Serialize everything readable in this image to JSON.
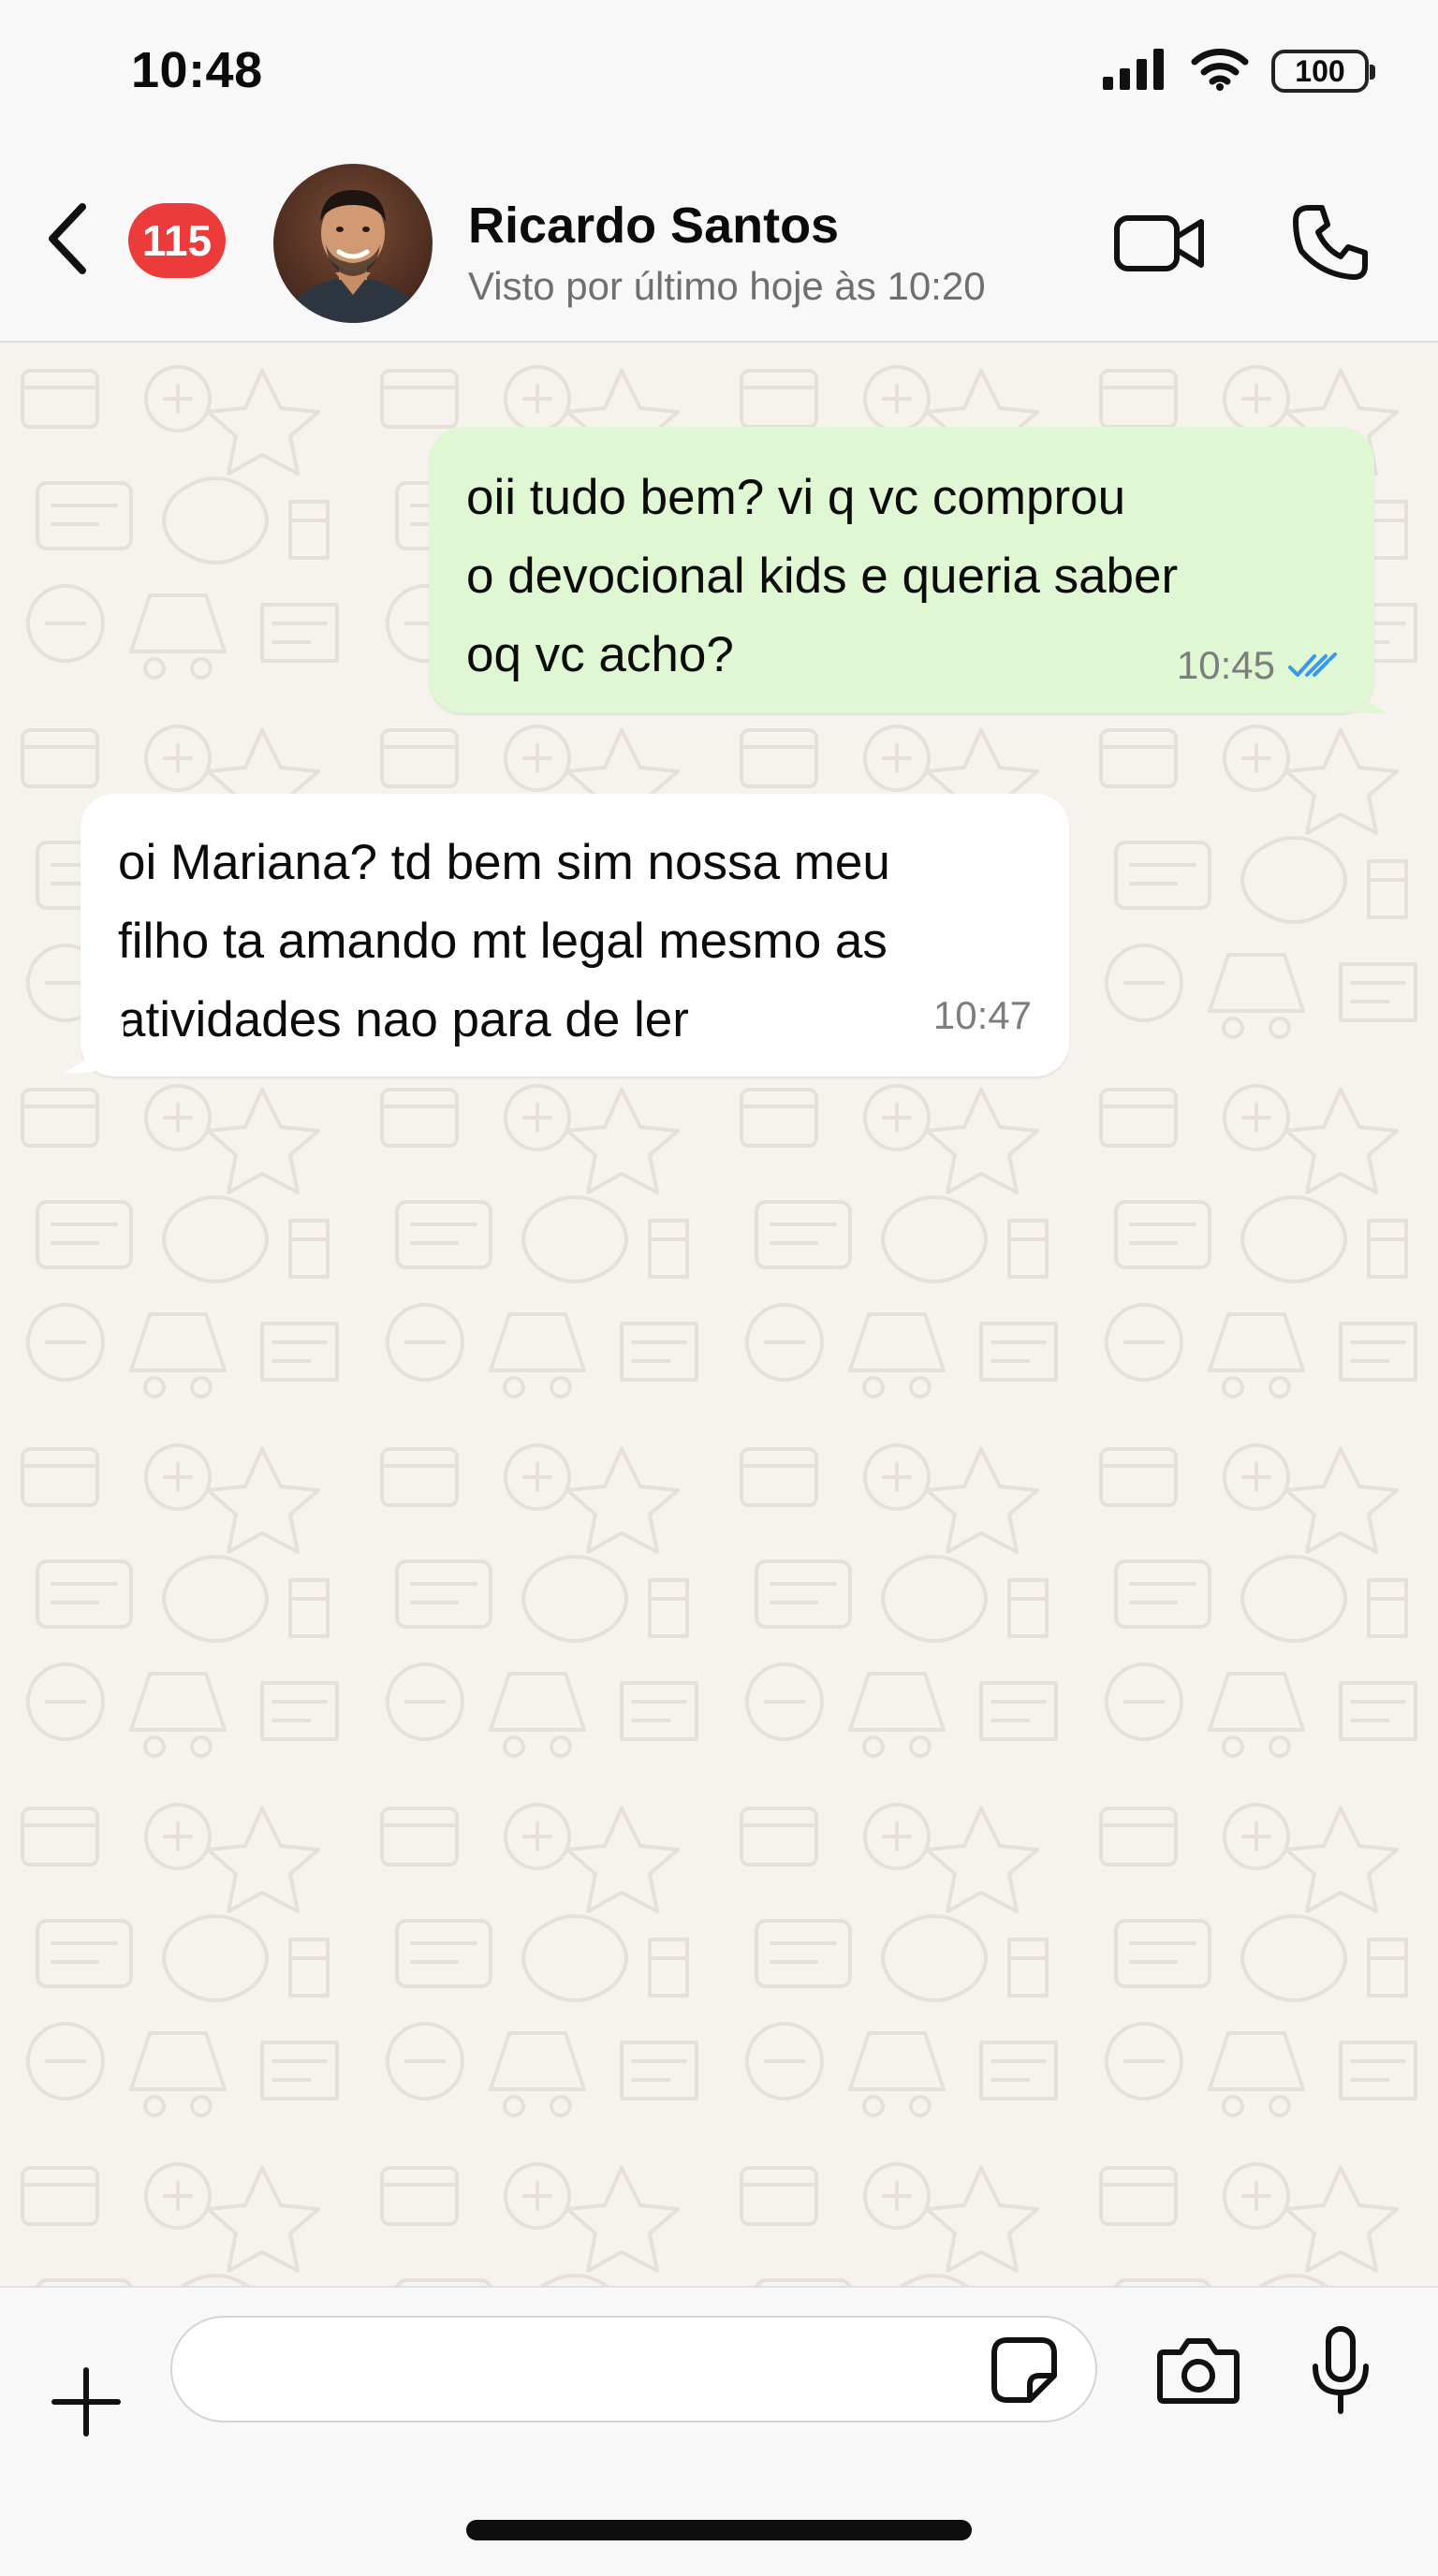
{
  "status_bar": {
    "time": "10:48",
    "battery": "100",
    "icons": [
      "cellular-signal-icon",
      "wifi-icon",
      "battery-icon"
    ]
  },
  "header": {
    "unread_count": "115",
    "contact_name": "Ricardo Santos",
    "last_seen": "Visto por último hoje às 10:20",
    "icons": [
      "back-chevron-icon",
      "video-camera-icon",
      "phone-icon"
    ]
  },
  "messages": [
    {
      "direction": "outgoing",
      "text": "oii tudo bem?  vi q vc comprou\no devocional kids e queria saber\noq vc acho?",
      "time": "10:45",
      "status": "read",
      "status_icon": "double-check-icon"
    },
    {
      "direction": "incoming",
      "text": "oi Mariana? td bem sim nossa meu\nfilho ta amando mt legal mesmo as\natividades nao para de ler",
      "time": "10:47"
    }
  ],
  "input_bar": {
    "placeholder": "",
    "value": "",
    "icons": [
      "plus-icon",
      "sticker-icon",
      "camera-icon",
      "microphone-icon"
    ]
  },
  "colors": {
    "outgoing_bubble": "#dff7d2",
    "incoming_bubble": "#ffffff",
    "chat_background": "#f6f3ef",
    "badge": "#ec3b3b",
    "read_check": "#3a97f0"
  }
}
